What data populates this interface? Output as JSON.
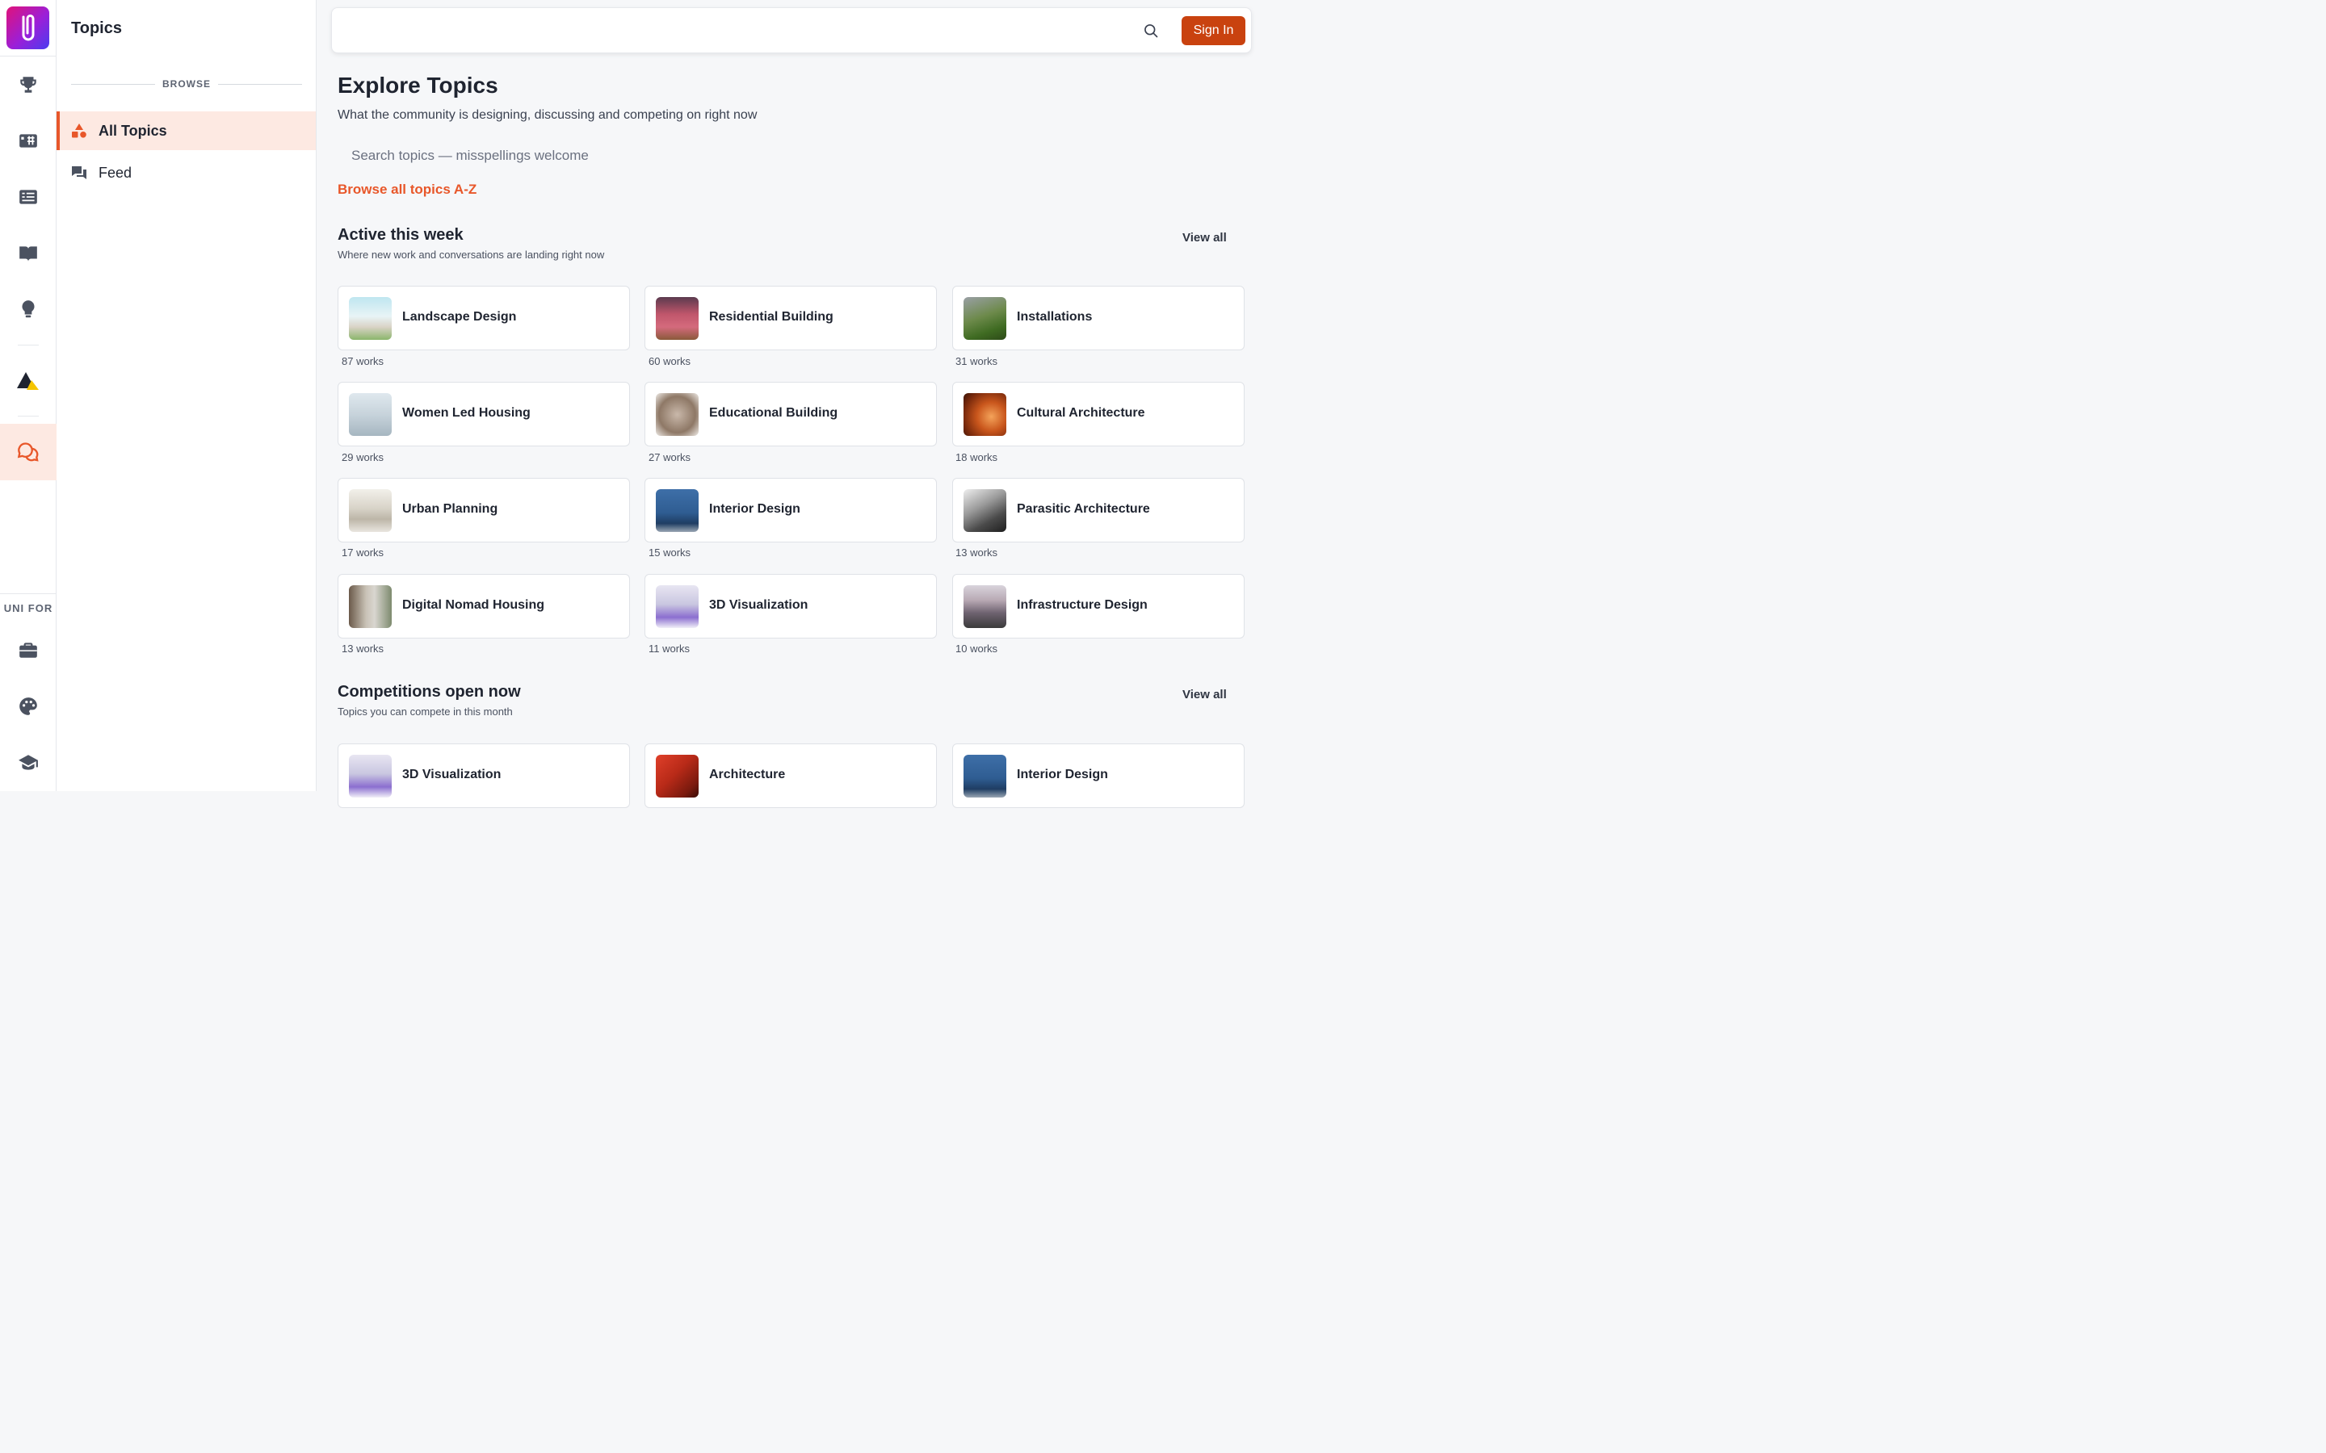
{
  "panel": {
    "title": "Topics",
    "browse_label": "BROWSE",
    "items": [
      {
        "label": "All Topics",
        "icon": "shapes-icon"
      },
      {
        "label": "Feed",
        "icon": "chat-icon"
      }
    ]
  },
  "rail": {
    "uni_for_label": "UNI FOR",
    "icons": [
      "trophy-icon",
      "hashtag-board-icon",
      "news-icon",
      "book-icon",
      "bulb-icon",
      "triangle-logo-icon",
      "chat-bubbles-icon",
      "briefcase-icon",
      "palette-icon",
      "graduation-cap-icon"
    ]
  },
  "header": {
    "search_icon": "search-icon",
    "sign_in_label": "Sign In"
  },
  "main": {
    "title": "Explore Topics",
    "subtitle": "What the community is designing, discussing and competing on right now",
    "search_placeholder": "Search topics — misspellings welcome",
    "browse_link": "Browse all topics A-Z"
  },
  "active": {
    "title": "Active this week",
    "subtitle": "Where new work and conversations are landing right now",
    "view_all": "View all",
    "cards": [
      {
        "name": "Landscape Design",
        "works": "87 works"
      },
      {
        "name": "Residential Building",
        "works": "60 works"
      },
      {
        "name": "Installations",
        "works": "31 works"
      },
      {
        "name": "Women Led Housing",
        "works": "29 works"
      },
      {
        "name": "Educational Building",
        "works": "27 works"
      },
      {
        "name": "Cultural Architecture",
        "works": "18 works"
      },
      {
        "name": "Urban Planning",
        "works": "17 works"
      },
      {
        "name": "Interior Design",
        "works": "15 works"
      },
      {
        "name": "Parasitic Architecture",
        "works": "13 works"
      },
      {
        "name": "Digital Nomad Housing",
        "works": "13 works"
      },
      {
        "name": "3D Visualization",
        "works": "11 works"
      },
      {
        "name": "Infrastructure Design",
        "works": "10 works"
      }
    ]
  },
  "competitions": {
    "title": "Competitions open now",
    "subtitle": "Topics you can compete in this month",
    "view_all": "View all",
    "cards": [
      {
        "name": "3D Visualization"
      },
      {
        "name": "Architecture"
      },
      {
        "name": "Interior Design"
      }
    ]
  },
  "colors": {
    "accent": "#e8572a",
    "sign_in_bg": "#c9420f",
    "active_bg": "#fde9e2"
  }
}
